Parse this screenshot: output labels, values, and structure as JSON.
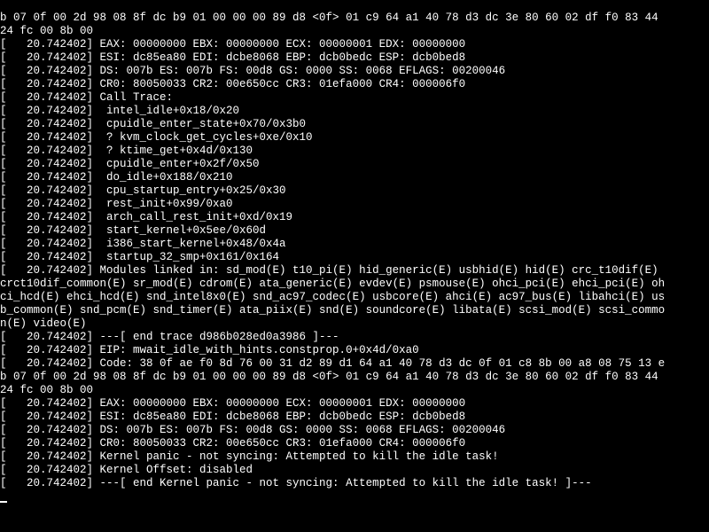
{
  "lines": [
    "b 07 0f 00 2d 98 08 8f dc b9 01 00 00 00 89 d8 <0f> 01 c9 64 a1 40 78 d3 dc 3e 80 60 02 df f0 83 44",
    "24 fc 00 8b 00",
    "[   20.742402] EAX: 00000000 EBX: 00000000 ECX: 00000001 EDX: 00000000",
    "[   20.742402] ESI: dc85ea80 EDI: dcbe8068 EBP: dcb0bedc ESP: dcb0bed8",
    "[   20.742402] DS: 007b ES: 007b FS: 00d8 GS: 0000 SS: 0068 EFLAGS: 00200046",
    "[   20.742402] CR0: 80050033 CR2: 00e650cc CR3: 01efa000 CR4: 000006f0",
    "[   20.742402] Call Trace:",
    "[   20.742402]  intel_idle+0x18/0x20",
    "[   20.742402]  cpuidle_enter_state+0x70/0x3b0",
    "[   20.742402]  ? kvm_clock_get_cycles+0xe/0x10",
    "[   20.742402]  ? ktime_get+0x4d/0x130",
    "[   20.742402]  cpuidle_enter+0x2f/0x50",
    "[   20.742402]  do_idle+0x188/0x210",
    "[   20.742402]  cpu_startup_entry+0x25/0x30",
    "[   20.742402]  rest_init+0x99/0xa0",
    "[   20.742402]  arch_call_rest_init+0xd/0x19",
    "[   20.742402]  start_kernel+0x5ee/0x60d",
    "[   20.742402]  i386_start_kernel+0x48/0x4a",
    "[   20.742402]  startup_32_smp+0x161/0x164",
    "[   20.742402] Modules linked in: sd_mod(E) t10_pi(E) hid_generic(E) usbhid(E) hid(E) crc_t10dif(E)",
    "crct10dif_common(E) sr_mod(E) cdrom(E) ata_generic(E) evdev(E) psmouse(E) ohci_pci(E) ehci_pci(E) oh",
    "ci_hcd(E) ehci_hcd(E) snd_intel8x0(E) snd_ac97_codec(E) usbcore(E) ahci(E) ac97_bus(E) libahci(E) us",
    "b_common(E) snd_pcm(E) snd_timer(E) ata_piix(E) snd(E) soundcore(E) libata(E) scsi_mod(E) scsi_commo",
    "n(E) video(E)",
    "[   20.742402] ---[ end trace d986b028ed0a3986 ]---",
    "[   20.742402] EIP: mwait_idle_with_hints.constprop.0+0x4d/0xa0",
    "[   20.742402] Code: 38 0f ae f0 8d 76 00 31 d2 89 d1 64 a1 40 78 d3 dc 0f 01 c8 8b 00 a8 08 75 13 e",
    "b 07 0f 00 2d 98 08 8f dc b9 01 00 00 00 89 d8 <0f> 01 c9 64 a1 40 78 d3 dc 3e 80 60 02 df f0 83 44",
    "24 fc 00 8b 00",
    "[   20.742402] EAX: 00000000 EBX: 00000000 ECX: 00000001 EDX: 00000000",
    "[   20.742402] ESI: dc85ea80 EDI: dcbe8068 EBP: dcb0bedc ESP: dcb0bed8",
    "[   20.742402] DS: 007b ES: 007b FS: 00d8 GS: 0000 SS: 0068 EFLAGS: 00200046",
    "[   20.742402] CR0: 80050033 CR2: 00e650cc CR3: 01efa000 CR4: 000006f0",
    "[   20.742402] Kernel panic - not syncing: Attempted to kill the idle task!",
    "[   20.742402] Kernel Offset: disabled",
    "[   20.742402] ---[ end Kernel panic - not syncing: Attempted to kill the idle task! ]---"
  ]
}
